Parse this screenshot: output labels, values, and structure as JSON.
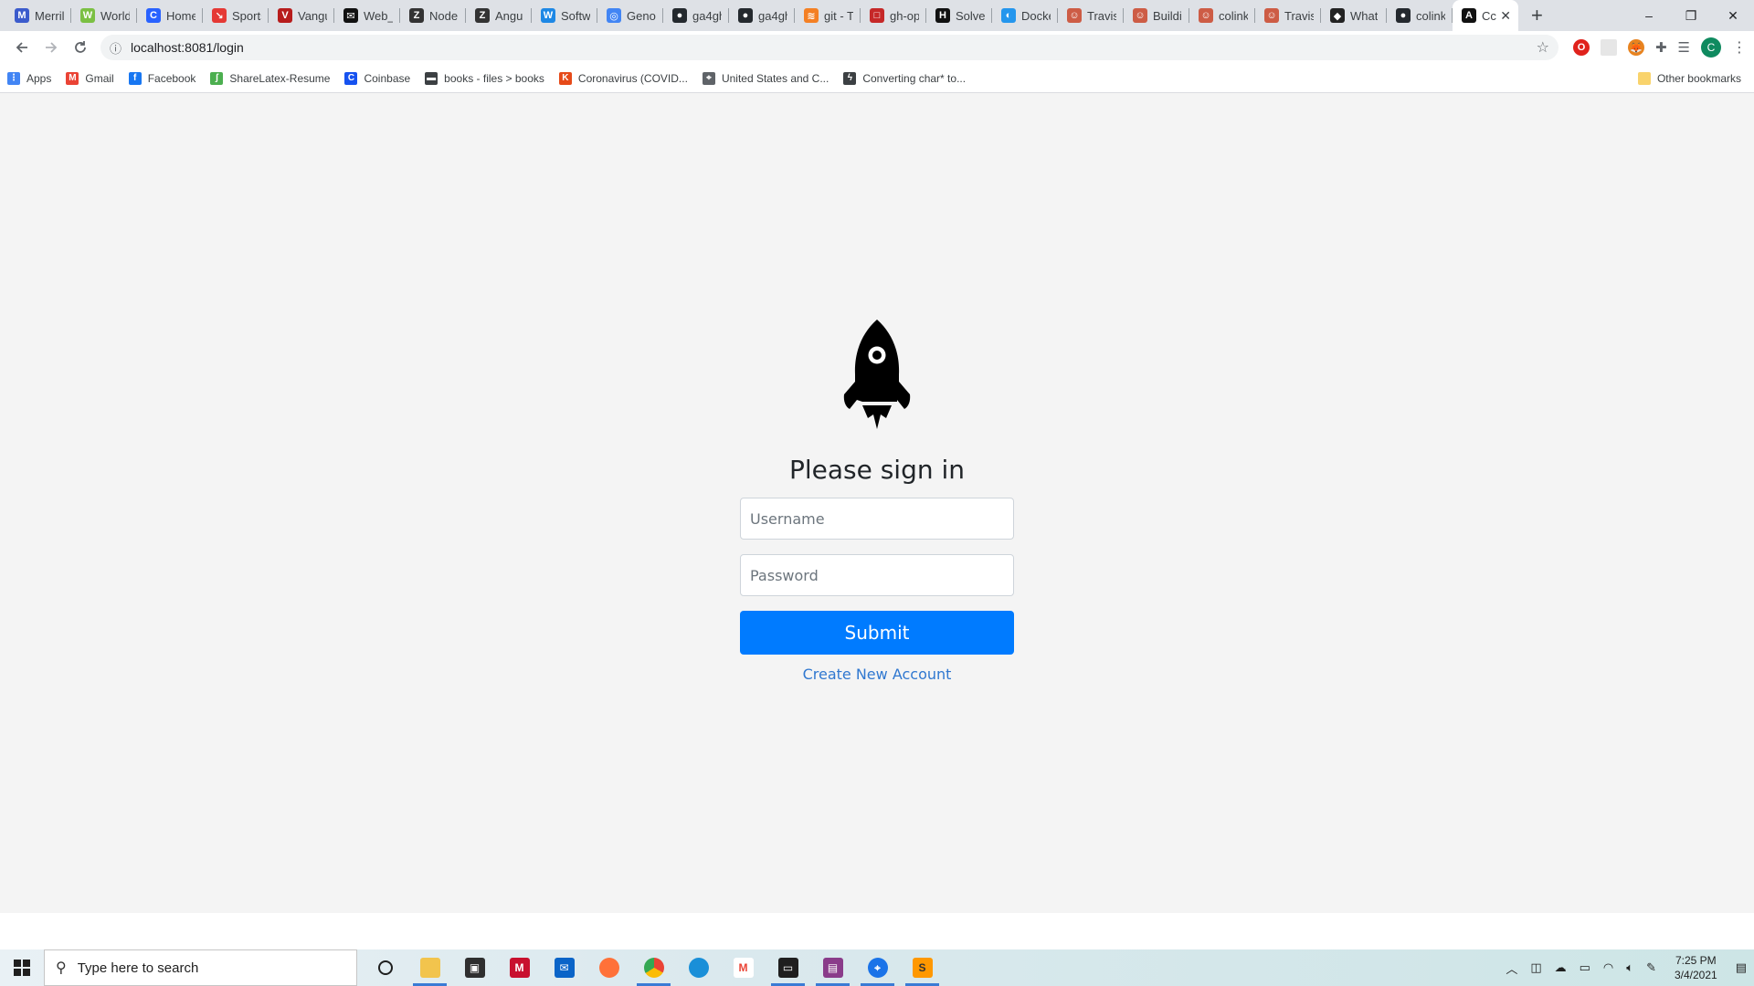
{
  "browser": {
    "tabs": [
      {
        "title": "Merril",
        "color": "#3b5bcc",
        "glyph": "M"
      },
      {
        "title": "World",
        "color": "#7bc043",
        "glyph": "W"
      },
      {
        "title": "Home",
        "color": "#2962ff",
        "glyph": "C"
      },
      {
        "title": "Sports",
        "color": "#e53935",
        "glyph": "↘"
      },
      {
        "title": "Vangu",
        "color": "#b71c1c",
        "glyph": "V"
      },
      {
        "title": "Web_A",
        "color": "#111111",
        "glyph": "✉"
      },
      {
        "title": "Node.",
        "color": "#333333",
        "glyph": "Z"
      },
      {
        "title": "Angu",
        "color": "#333333",
        "glyph": "Z"
      },
      {
        "title": "Softw",
        "color": "#1e88e5",
        "glyph": "W"
      },
      {
        "title": "Genor",
        "color": "#4285f4",
        "glyph": "◎"
      },
      {
        "title": "ga4gh",
        "color": "#24292e",
        "glyph": "●"
      },
      {
        "title": "ga4gh",
        "color": "#24292e",
        "glyph": "●"
      },
      {
        "title": "git - T",
        "color": "#f48024",
        "glyph": "≋"
      },
      {
        "title": "gh-op",
        "color": "#c62828",
        "glyph": "□"
      },
      {
        "title": "Solve",
        "color": "#111111",
        "glyph": "H"
      },
      {
        "title": "Docke",
        "color": "#2496ed",
        "glyph": "◐"
      },
      {
        "title": "Travis",
        "color": "#cd5c45",
        "glyph": "☺"
      },
      {
        "title": "Buildi",
        "color": "#cd5c45",
        "glyph": "☺"
      },
      {
        "title": "colink",
        "color": "#cd5c45",
        "glyph": "☺"
      },
      {
        "title": "Travis",
        "color": "#cd5c45",
        "glyph": "☺"
      },
      {
        "title": "What",
        "color": "#222222",
        "glyph": "◆"
      },
      {
        "title": "colink",
        "color": "#24292e",
        "glyph": "●"
      }
    ],
    "active_tab": {
      "title": "Cc",
      "glyph": "A",
      "color": "#111111"
    },
    "new_tab": "+",
    "window_controls": {
      "minimize": "–",
      "maximize": "❐",
      "close": "✕"
    },
    "url": "localhost:8081/login",
    "bookmarks": [
      {
        "label": "Apps",
        "color": "#4285f4",
        "glyph": "⋮"
      },
      {
        "label": "Gmail",
        "color": "#ea4335",
        "glyph": "M"
      },
      {
        "label": "Facebook",
        "color": "#1877f2",
        "glyph": "f"
      },
      {
        "label": "ShareLatex-Resume",
        "color": "#4caf50",
        "glyph": "ʃ"
      },
      {
        "label": "Coinbase",
        "color": "#1652f0",
        "glyph": "C"
      },
      {
        "label": "books - files > books",
        "color": "#3c4043",
        "glyph": "▬"
      },
      {
        "label": "Coronavirus (COVID...",
        "color": "#e64a19",
        "glyph": "K"
      },
      {
        "label": "United States and C...",
        "color": "#5f6368",
        "glyph": "⌖"
      },
      {
        "label": "Converting char* to...",
        "color": "#3c4043",
        "glyph": "ϟ"
      }
    ],
    "other_bookmarks": "Other bookmarks",
    "profile_initial": "C"
  },
  "login": {
    "heading": "Please sign in",
    "username_placeholder": "Username",
    "password_placeholder": "Password",
    "submit_label": "Submit",
    "create_account_label": "Create New Account",
    "primary_color": "#007bff"
  },
  "taskbar": {
    "search_placeholder": "Type here to search",
    "time": "7:25 PM",
    "date": "3/4/2021"
  }
}
